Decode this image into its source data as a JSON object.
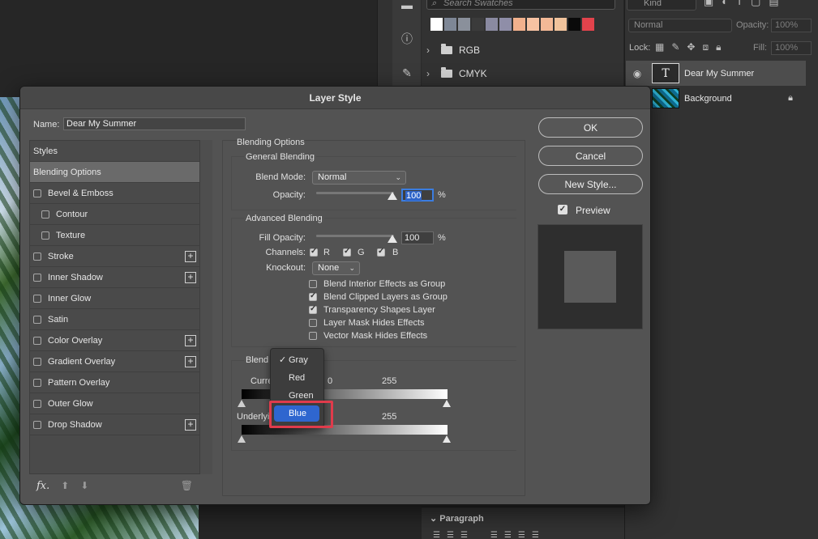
{
  "swatches": {
    "search_placeholder": "Search Swatches",
    "colors": [
      "#ffffff",
      "#7e8796",
      "#8a909b",
      "#3b3b3b",
      "#8a8aa1",
      "#8f8ea8",
      "#f2b18d",
      "#f7c2a2",
      "#f4b996",
      "#f1c39c",
      "#0a0a0a",
      "#e2434c"
    ],
    "groups": [
      {
        "label": "RGB"
      },
      {
        "label": "CMYK"
      }
    ]
  },
  "layers_panel": {
    "kind_label": "Kind",
    "blend_mode": "Normal",
    "opacity_label": "Opacity:",
    "opacity_value": "100%",
    "lock_label": "Lock:",
    "fill_label": "Fill:",
    "fill_value": "100%",
    "layers": [
      {
        "name": "Dear My Summer",
        "type": "text"
      },
      {
        "name": "Background",
        "type": "image"
      }
    ]
  },
  "paragraph_panel": {
    "title": "Paragraph"
  },
  "dialog": {
    "title": "Layer Style",
    "name_label": "Name:",
    "name_value": "Dear My Summer",
    "styles": [
      {
        "label": "Styles"
      },
      {
        "label": "Blending Options"
      },
      {
        "label": "Bevel & Emboss"
      },
      {
        "label": "Contour"
      },
      {
        "label": "Texture"
      },
      {
        "label": "Stroke"
      },
      {
        "label": "Inner Shadow"
      },
      {
        "label": "Inner Glow"
      },
      {
        "label": "Satin"
      },
      {
        "label": "Color Overlay"
      },
      {
        "label": "Gradient Overlay"
      },
      {
        "label": "Pattern Overlay"
      },
      {
        "label": "Outer Glow"
      },
      {
        "label": "Drop Shadow"
      }
    ],
    "options": {
      "section_title": "Blending Options",
      "general": {
        "title": "General Blending",
        "blend_mode_label": "Blend Mode:",
        "blend_mode_value": "Normal",
        "opacity_label": "Opacity:",
        "opacity_value": "100",
        "percent": "%"
      },
      "advanced": {
        "title": "Advanced Blending",
        "fill_opacity_label": "Fill Opacity:",
        "fill_opacity_value": "100",
        "percent": "%",
        "channels_label": "Channels:",
        "channel_r": "R",
        "channel_g": "G",
        "channel_b": "B",
        "knockout_label": "Knockout:",
        "knockout_value": "None",
        "checks": [
          {
            "label": "Blend Interior Effects as Group",
            "checked": false
          },
          {
            "label": "Blend Clipped Layers as Group",
            "checked": true
          },
          {
            "label": "Transparency Shapes Layer",
            "checked": true
          },
          {
            "label": "Layer Mask Hides Effects",
            "checked": false
          },
          {
            "label": "Vector Mask Hides Effects",
            "checked": false
          }
        ]
      },
      "blend_if": {
        "title": "Blend",
        "current_label": "Curre",
        "underlying_label": "Underlyi",
        "current_min": "0",
        "current_max": "255",
        "underlying_max": "255"
      }
    },
    "buttons": {
      "ok": "OK",
      "cancel": "Cancel",
      "new_style": "New Style...",
      "preview": "Preview"
    },
    "dropdown": {
      "items": [
        {
          "label": "Gray",
          "checked": true
        },
        {
          "label": "Red",
          "checked": false
        },
        {
          "label": "Green",
          "checked": false
        },
        {
          "label": "Blue",
          "checked": false,
          "highlighted": true
        }
      ],
      "tick": "✓"
    }
  }
}
